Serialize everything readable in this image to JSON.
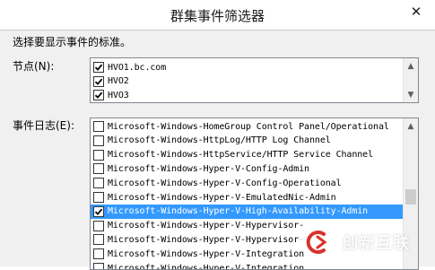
{
  "window": {
    "title": "群集事件筛选器",
    "close_glyph": "✕"
  },
  "instruction": "选择要显示事件的标准。",
  "nodes": {
    "label": "节点(N):",
    "items": [
      {
        "label": "HVO1.bc.com",
        "checked": true
      },
      {
        "label": "HVO2",
        "checked": true
      },
      {
        "label": "HVO3",
        "checked": true
      }
    ]
  },
  "event_logs": {
    "label": "事件日志(E):",
    "items": [
      {
        "label": "Microsoft-Windows-HomeGroup Control Panel/Operational",
        "checked": false,
        "selected": false
      },
      {
        "label": "Microsoft-Windows-HttpLog/HTTP Log Channel",
        "checked": false,
        "selected": false
      },
      {
        "label": "Microsoft-Windows-HttpService/HTTP Service Channel",
        "checked": false,
        "selected": false
      },
      {
        "label": "Microsoft-Windows-Hyper-V-Config-Admin",
        "checked": false,
        "selected": false
      },
      {
        "label": "Microsoft-Windows-Hyper-V-Config-Operational",
        "checked": false,
        "selected": false
      },
      {
        "label": "Microsoft-Windows-Hyper-V-EmulatedNic-Admin",
        "checked": false,
        "selected": false
      },
      {
        "label": "Microsoft-Windows-Hyper-V-High-Availability-Admin",
        "checked": true,
        "selected": true
      },
      {
        "label": "Microsoft-Windows-Hyper-V-Hypervisor-",
        "checked": false,
        "selected": false
      },
      {
        "label": "Microsoft-Windows-Hyper-V-Hypervisor-",
        "checked": false,
        "selected": false
      },
      {
        "label": "Microsoft-Windows-Hyper-V-Integration",
        "checked": false,
        "selected": false
      },
      {
        "label": "Microsoft-Windows-Hyper-V-Integration",
        "checked": false,
        "selected": false
      }
    ]
  },
  "watermark": {
    "text": "创新互联"
  },
  "colors": {
    "selection": "#3399ff",
    "dialog_bg": "#f0f0f0",
    "watermark_red": "#d9322b"
  },
  "icons": {
    "close": "close-icon",
    "scroll_up": "scroll-up-icon",
    "scroll_down": "scroll-down-icon",
    "checkmark": "checkmark-icon"
  }
}
